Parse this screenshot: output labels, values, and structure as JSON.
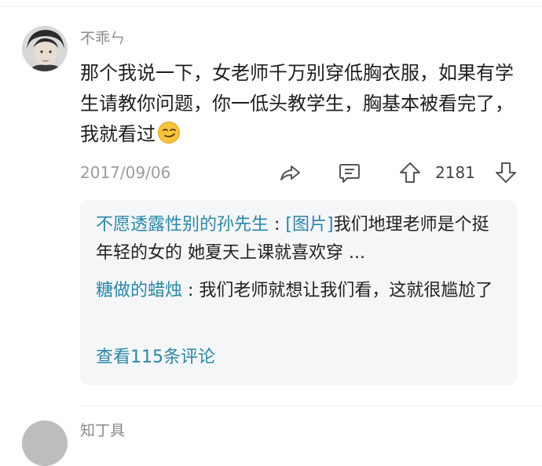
{
  "comment": {
    "username": "不乖ㄣ",
    "avatar_icon": "user-avatar-photo",
    "text": "那个我说一下，女老师千万别穿低胸衣服，如果有学生请教你问题，你一低头教学生，胸基本被看完了，我就看过",
    "emoji_icon": "smirk-emoji",
    "date": "2017/09/06",
    "actions": {
      "share_icon": "share-icon",
      "reply_icon": "comment-icon",
      "upvote_icon": "upvote-arrow-icon",
      "like_count": "2181",
      "downvote_icon": "downvote-arrow-icon"
    }
  },
  "replies": [
    {
      "author": "不愿透露性别的孙先生",
      "separator": " : ",
      "image_tag": "[图片]",
      "text": "我们地理老师是个挺年轻的女的 她夏天上课就喜欢穿 ..."
    },
    {
      "author": "糖做的蜡烛",
      "separator": " : ",
      "text": "我们老师就想让我们看，这就很尴尬了"
    }
  ],
  "view_more": "查看115条评论",
  "next_comment": {
    "username_partial": "知丁具"
  },
  "colors": {
    "link": "#2a87a8",
    "reply_bg": "#f5f6f8",
    "meta_gray": "#9c9c9c"
  }
}
